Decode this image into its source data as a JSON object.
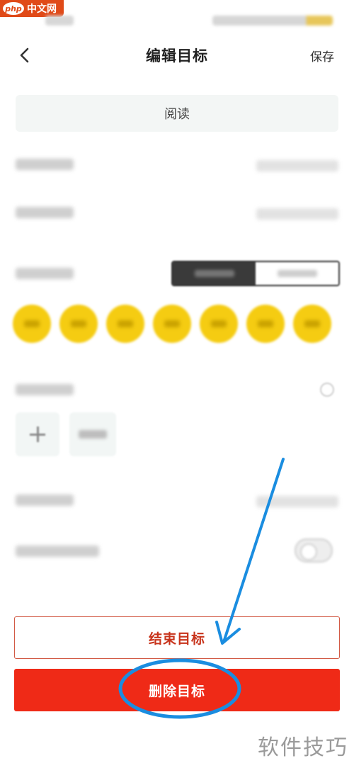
{
  "watermark_top": {
    "logo": "php",
    "text": "中文网"
  },
  "nav": {
    "title": "编辑目标",
    "save_label": "保存",
    "back_icon": "chevron-left-icon"
  },
  "goal_name": {
    "value": "阅读"
  },
  "actions": {
    "end_label": "结束目标",
    "delete_label": "删除目标"
  },
  "colors": {
    "accent_yellow": "#f5cc12",
    "delete_red": "#ef2a17",
    "end_border": "#d25a45",
    "annotation_blue": "#1a8de0"
  },
  "watermark_bottom": {
    "text": "软件技巧"
  }
}
